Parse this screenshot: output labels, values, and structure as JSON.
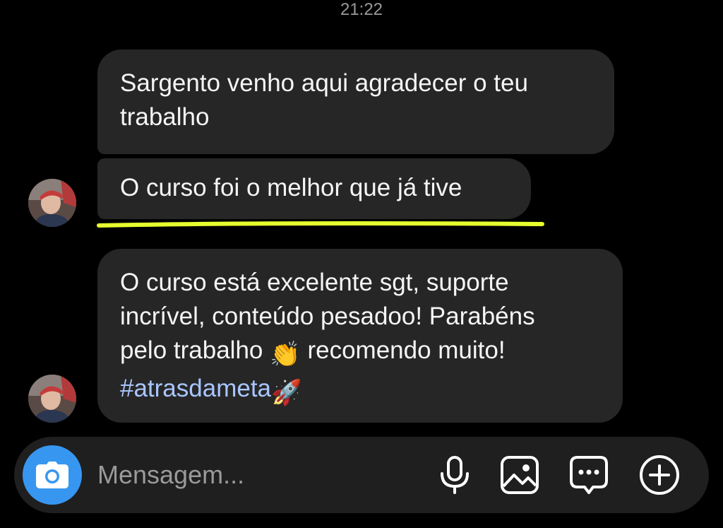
{
  "header": {
    "time": "21:22"
  },
  "messages": [
    {
      "text": "Sargento venho aqui agradecer o teu\ntrabalho"
    },
    {
      "text": "O curso foi o melhor que já tive"
    },
    {
      "line1": "O curso está excelente sgt, suporte",
      "line2": "incrível, conteúdo pesadoo! Parabéns",
      "line3a": "pelo trabalho",
      "emoji_clap": "👏",
      "line3b": "recomendo muito!",
      "hashtag": "#atrasdameta",
      "emoji_rocket": "🚀"
    }
  ],
  "composer": {
    "placeholder": "Mensagem...",
    "icons": [
      "camera-icon",
      "microphone-icon",
      "gallery-icon",
      "sticker-icon",
      "plus-icon"
    ]
  },
  "colors": {
    "background": "#000000",
    "bubble": "#262626",
    "hashtag": "#a9c6ff",
    "highlight": "#e6ff2e",
    "camera_button": "#3797f0",
    "composer": "#1f1f1f"
  }
}
